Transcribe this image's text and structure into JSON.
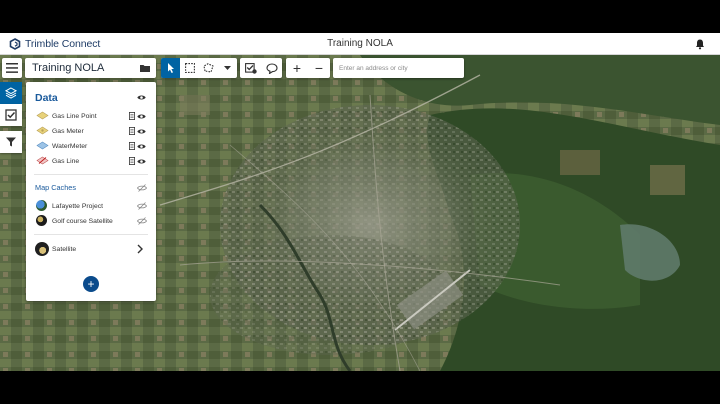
{
  "app": {
    "brand_primary": "Trimble",
    "brand_secondary": "Connect",
    "window_title": "Training NOLA",
    "brand_color": "#1f3c66",
    "accent_color": "#0063a3"
  },
  "toolbar": {
    "project_name": "Training NOLA",
    "zoom_in": "+",
    "zoom_out": "−",
    "address_placeholder": "Enter an address or city",
    "icons": [
      "menu-icon",
      "folder-icon",
      "pointer-icon",
      "rectangle-select-icon",
      "lasso-select-icon",
      "dropdown-icon",
      "markup-check-icon",
      "comment-icon"
    ]
  },
  "rail": {
    "items": [
      "layers-icon",
      "checklist-icon",
      "filter-icon"
    ]
  },
  "panel": {
    "title": "Data",
    "layers": [
      {
        "label": "Gas Line Point",
        "icon": "layer-point-icon"
      },
      {
        "label": "Gas Meter",
        "icon": "layer-meter-icon"
      },
      {
        "label": "WaterMeter",
        "icon": "layer-water-icon"
      },
      {
        "label": "Gas Line",
        "icon": "layer-line-icon"
      }
    ],
    "caches_title": "Map Caches",
    "caches": [
      {
        "label": "Lafayette Project"
      },
      {
        "label": "Golf course Satellite"
      }
    ],
    "basemap": {
      "label": "Satellite"
    },
    "add_label": "+"
  }
}
